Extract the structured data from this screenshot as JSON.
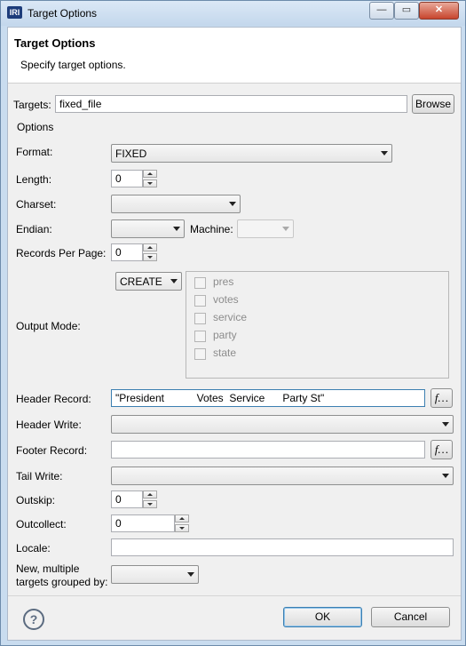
{
  "window": {
    "app_icon": "IRI",
    "title": "Target Options",
    "minimize": "—",
    "maximize": "▭",
    "close": "✕"
  },
  "banner": {
    "title": "Target Options",
    "description": "Specify target options."
  },
  "targets": {
    "label": "Targets:",
    "value": "fixed_file",
    "browse": "Browse"
  },
  "options": {
    "title": "Options",
    "format": {
      "label": "Format:",
      "value": "FIXED"
    },
    "length": {
      "label": "Length:",
      "value": "0"
    },
    "charset": {
      "label": "Charset:",
      "value": ""
    },
    "endian": {
      "label": "Endian:",
      "value": ""
    },
    "machine": {
      "label": "Machine:",
      "value": ""
    },
    "records_per_page": {
      "label": "Records Per Page:",
      "value": "0"
    },
    "output_mode": {
      "label": "Output Mode:",
      "value": "CREATE",
      "fields": [
        "pres",
        "votes",
        "service",
        "party",
        "state"
      ]
    },
    "header_record": {
      "label": "Header Record:",
      "value": "\"President           Votes  Service      Party St\"",
      "fx": "f…"
    },
    "header_write": {
      "label": "Header Write:",
      "value": ""
    },
    "footer_record": {
      "label": "Footer Record:",
      "value": "",
      "fx": "f…"
    },
    "tail_write": {
      "label": "Tail Write:",
      "value": ""
    },
    "outskip": {
      "label": "Outskip:",
      "value": "0"
    },
    "outcollect": {
      "label": "Outcollect:",
      "value": "0"
    },
    "locale": {
      "label": "Locale:",
      "value": ""
    },
    "grouped_by": {
      "label_line1": "New, multiple",
      "label_line2": "targets grouped by:",
      "value": ""
    }
  },
  "footer": {
    "help": "?",
    "ok": "OK",
    "cancel": "Cancel"
  },
  "colors": {
    "accent": "#3c7fb1",
    "title_gradient": "#c3d7ec"
  },
  "icons": {
    "help": "help-circle-icon",
    "app": "iri-logo-icon"
  }
}
